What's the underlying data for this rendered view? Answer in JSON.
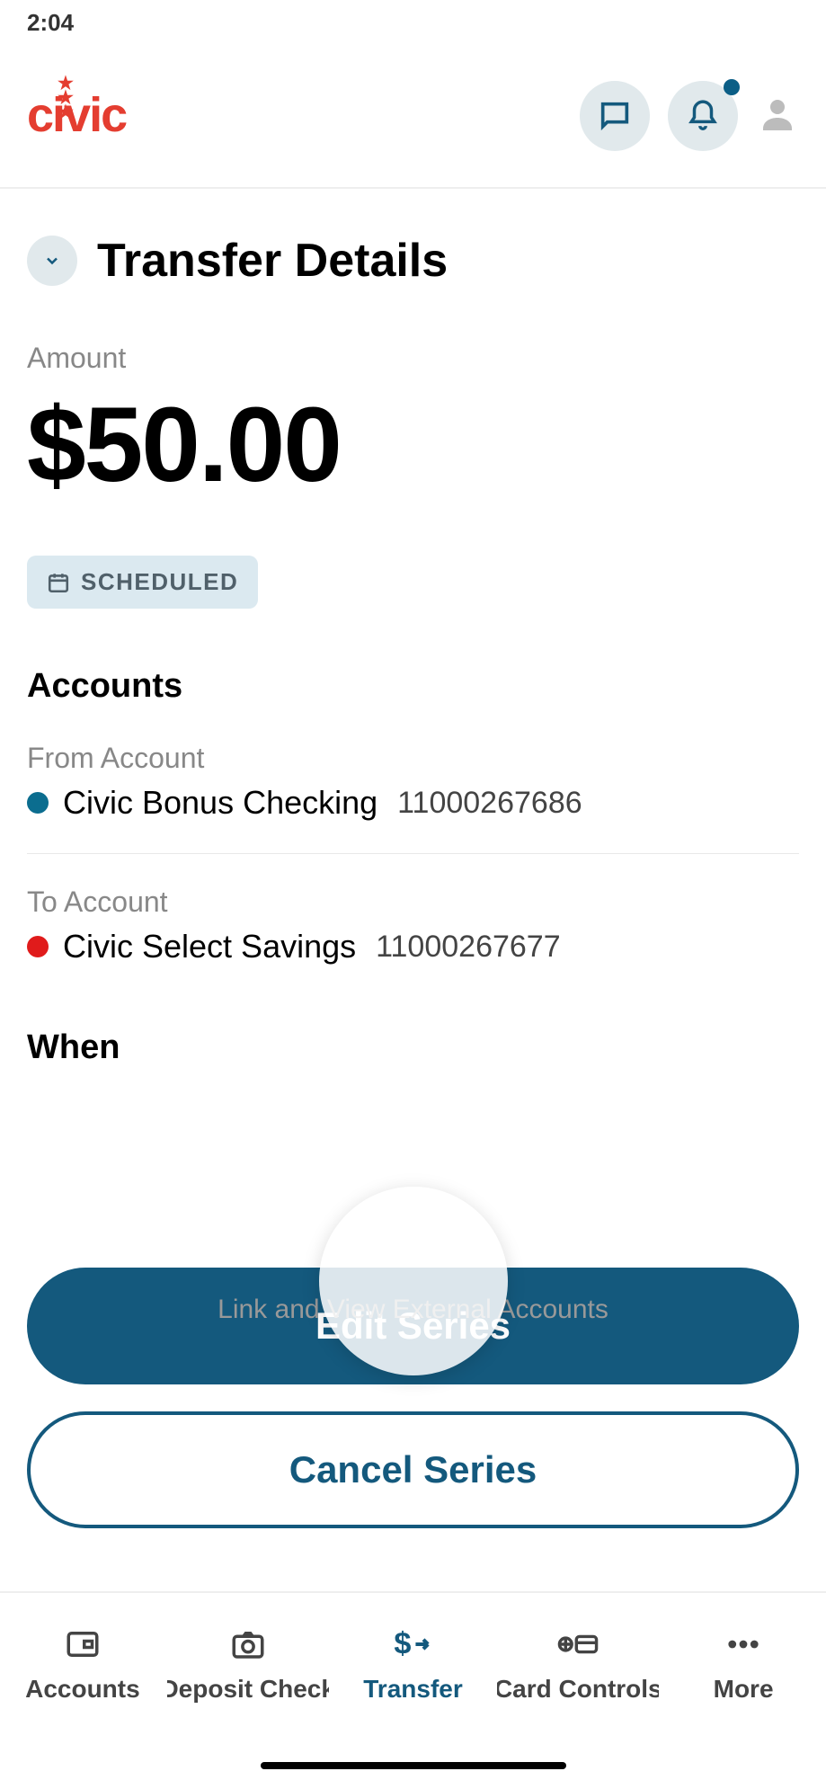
{
  "status_bar": {
    "time": "2:04"
  },
  "brand": "civic",
  "header": {
    "has_notification_dot": true
  },
  "transfer": {
    "title": "Transfer Details",
    "amount_label": "Amount",
    "amount": "$50.00",
    "status_badge": "SCHEDULED",
    "accounts_heading": "Accounts",
    "from_label": "From Account",
    "from_account": {
      "name": "Civic Bonus Checking",
      "number": "11000267686",
      "dot_color": "#0b6d8f"
    },
    "to_label": "To Account",
    "to_account": {
      "name": "Civic Select Savings",
      "number": "11000267677",
      "dot_color": "#e01b1b"
    },
    "when_heading": "When",
    "ghost_link_text": "Link and View External Accounts",
    "edit_button": "Edit Series",
    "cancel_button": "Cancel Series"
  },
  "nav": {
    "items": [
      {
        "label": "Accounts"
      },
      {
        "label": "Deposit Check"
      },
      {
        "label": "Transfer"
      },
      {
        "label": "Card Controls"
      },
      {
        "label": "More"
      }
    ],
    "active_index": 2
  }
}
